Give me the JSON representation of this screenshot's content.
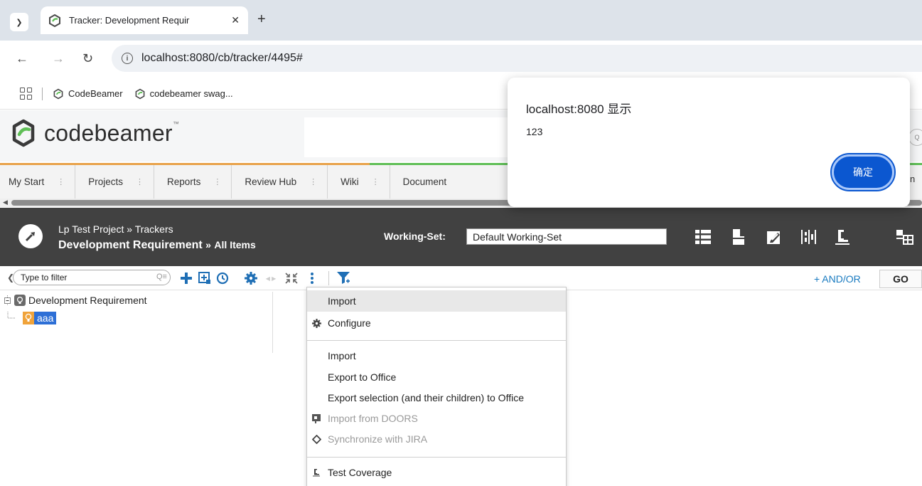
{
  "browser": {
    "tab_title": "Tracker: Development Requir",
    "url": "localhost:8080/cb/tracker/4495#",
    "bookmarks": [
      {
        "label": "CodeBeamer"
      },
      {
        "label": "codebeamer swag..."
      }
    ]
  },
  "app": {
    "brand_name": "codebeamer",
    "brand_trademark": "™",
    "brand_color": "#5fbf56",
    "nav_items": [
      {
        "label": "My Start"
      },
      {
        "label": "Projects"
      },
      {
        "label": "Reports"
      },
      {
        "label": "Review Hub"
      },
      {
        "label": "Wiki"
      },
      {
        "label": "Document"
      }
    ],
    "nav_overflow_text": "n"
  },
  "tracker": {
    "breadcrumb_project": "Lp Test Project",
    "breadcrumb_sep": "»",
    "breadcrumb_trackers": "Trackers",
    "tracker_name": "Development Requirement",
    "view_name": "All Items",
    "working_set_label": "Working-Set:",
    "working_set_value": "Default Working-Set",
    "header_icons": [
      "list-view-icon",
      "document-view-icon",
      "edit-document-icon",
      "planner-icon",
      "test-coverage-icon",
      "layout-icon"
    ]
  },
  "toolbar": {
    "filter_placeholder": "Type to filter",
    "and_or_label": "+ AND/OR",
    "go_label": "GO"
  },
  "tree": {
    "root_label": "Development Requirement",
    "child_label": "aaa"
  },
  "context_menu": {
    "items": [
      {
        "label": "Import",
        "highlight": true
      },
      {
        "label": "Configure",
        "icon": "gear-icon"
      },
      {
        "label": "Import"
      },
      {
        "label": "Export to Office"
      },
      {
        "label": "Export selection (and their children) to Office"
      },
      {
        "label": "Import from DOORS",
        "icon": "doors-icon",
        "disabled": true
      },
      {
        "label": "Synchronize with JIRA",
        "icon": "jira-icon",
        "disabled": true
      },
      {
        "label": "Test Coverage",
        "icon": "test-coverage-icon"
      }
    ]
  },
  "alert": {
    "title": "localhost:8080 显示",
    "message": "123",
    "ok_label": "确定"
  }
}
